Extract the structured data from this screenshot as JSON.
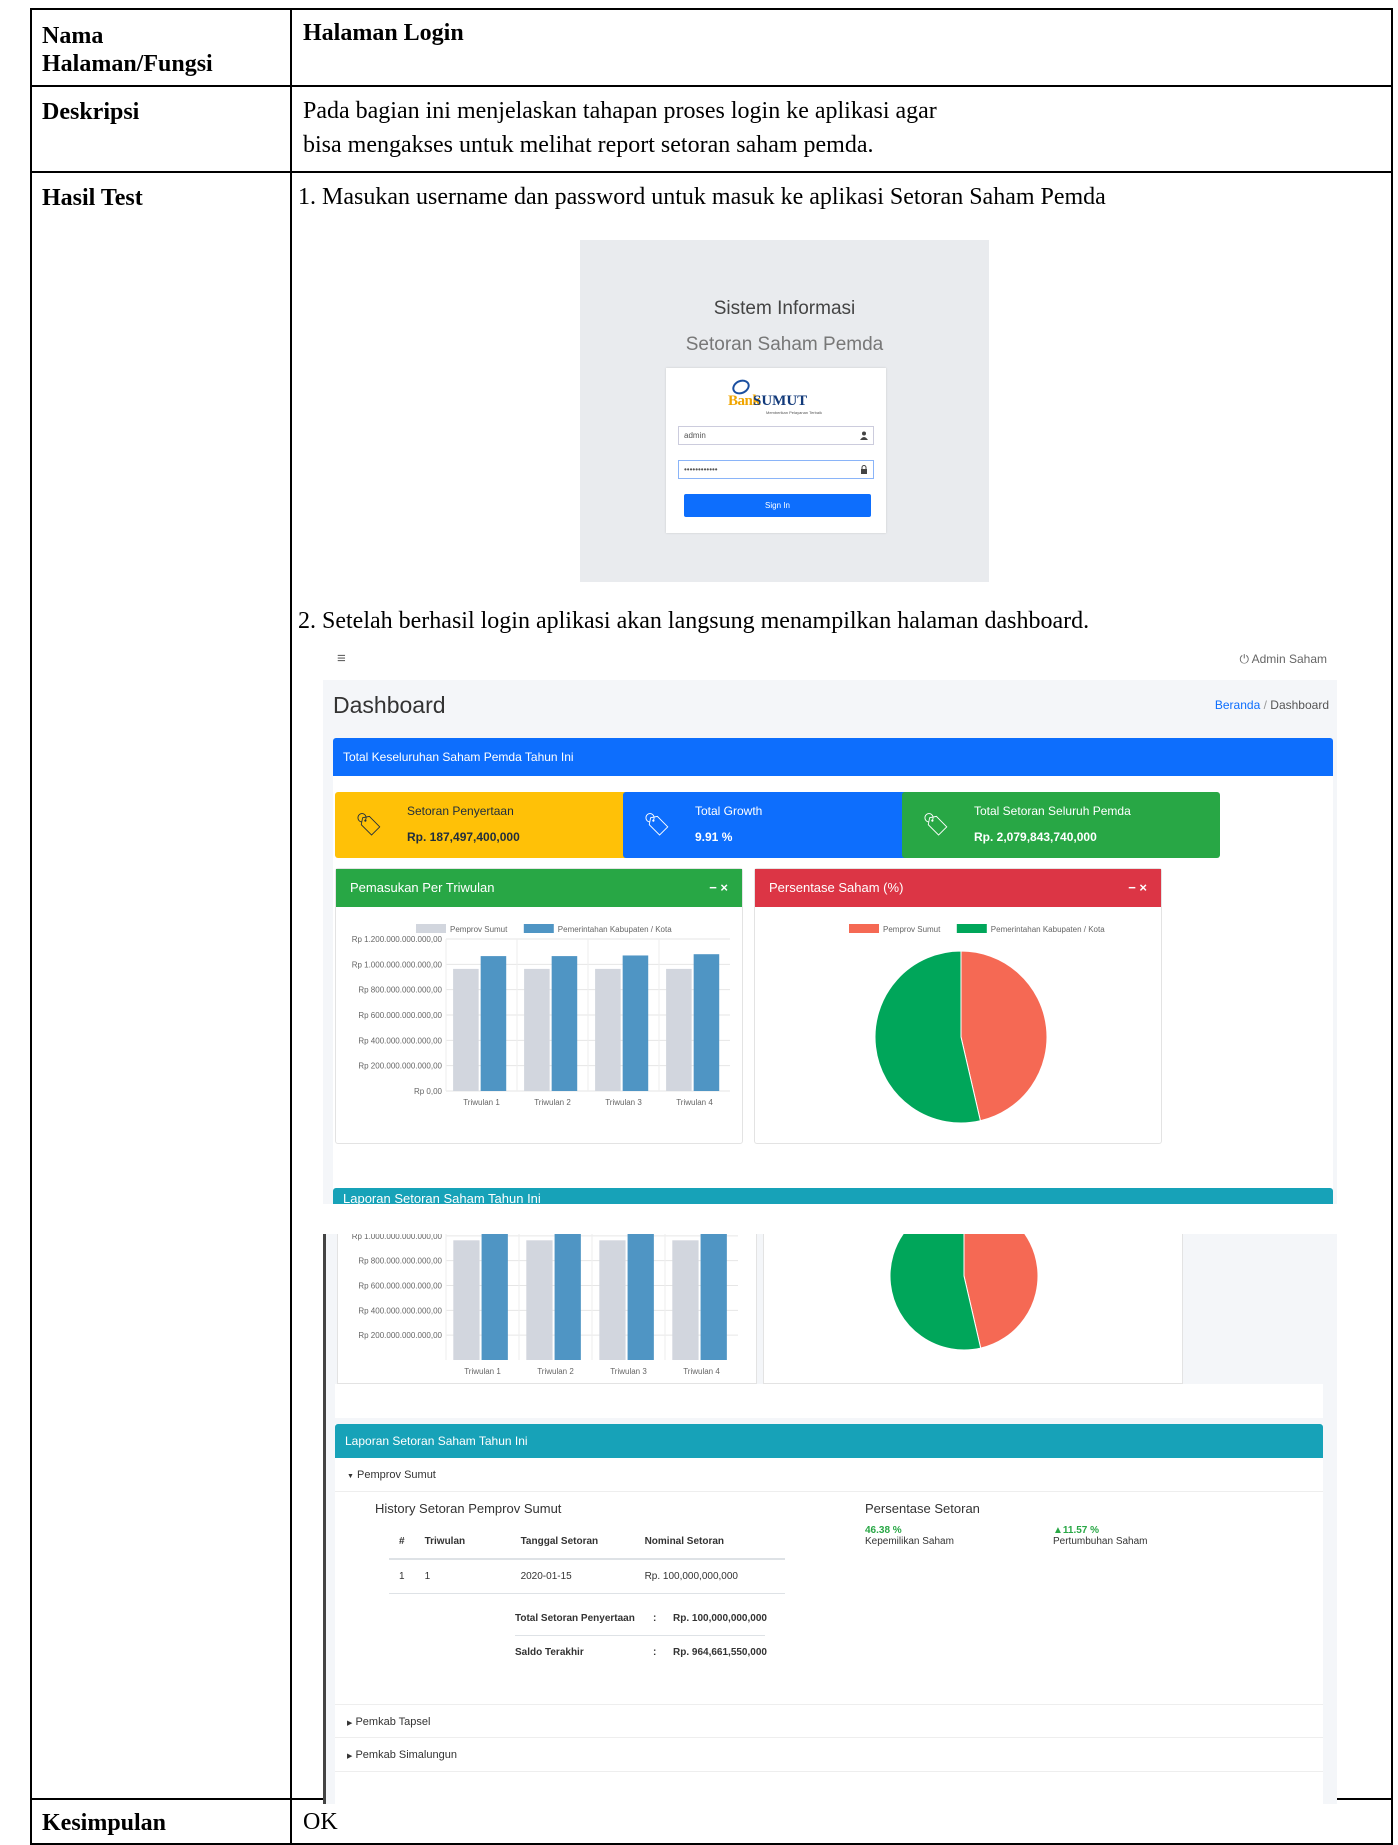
{
  "doc": {
    "rows": [
      {
        "label": "Nama Halaman/Fungsi",
        "value": "Halaman Login"
      },
      {
        "label": "Deskripsi",
        "value_line1": "Pada bagian ini menjelaskan tahapan proses login ke aplikasi agar",
        "value_line2": "bisa mengakses untuk melihat report setoran saham pemda."
      },
      {
        "label": "Hasil Test",
        "step1": "1.   Masukan username dan password untuk masuk ke aplikasi Setoran Saham Pemda",
        "step2": "2.   Setelah berhasil login aplikasi akan langsung menampilkan halaman dashboard."
      },
      {
        "label": "Kesimpulan",
        "value": "OK"
      }
    ]
  },
  "login": {
    "title": "Sistem Informasi",
    "subtitle": "Setoran Saham Pemda",
    "logo_bank": "Bank",
    "logo_name": "SUMUT",
    "logo_tagline": "Memberikan Pelayanan Terbaik",
    "username": "admin",
    "password": "••••••••••••",
    "button": "Sign In",
    "icons": {
      "user": "user-icon",
      "lock": "lock-icon"
    }
  },
  "dashboard": {
    "menu_icon": "≡",
    "user": "Admin Saham",
    "title": "Dashboard",
    "breadcrumb_home": "Beranda",
    "breadcrumb_sep": "/",
    "breadcrumb_current": "Dashboard",
    "panel_title": "Total Keseluruhan Saham Pemda Tahun Ini",
    "info_boxes": [
      {
        "label": "Setoran Penyertaan",
        "value": "Rp. 187,497,400,000",
        "color": "#ffc107"
      },
      {
        "label": "Total Growth",
        "value": "9.91 %",
        "color": "#0d6efd"
      },
      {
        "label": "Total Setoran Seluruh Pemda",
        "value": "Rp. 2,079,843,740,000",
        "color": "#28a745"
      }
    ],
    "bar_box_title": "Pemasukan Per Triwulan",
    "pie_box_title": "Persentase Saham (%)",
    "box_controls": "−   ×",
    "lower_panel_title": "Laporan Setoran Saham Tahun Ini"
  },
  "chart_data": [
    {
      "type": "bar",
      "categories": [
        "Triwulan 1",
        "Triwulan 2",
        "Triwulan 3",
        "Triwulan 4"
      ],
      "series": [
        {
          "name": "Pemprov Sumut",
          "values": [
            964000000000,
            964000000000,
            964000000000,
            964000000000
          ],
          "color": "#d2d6de"
        },
        {
          "name": "Pemerintahan Kabupaten / Kota",
          "values": [
            1065000000000,
            1065000000000,
            1070000000000,
            1080000000000
          ],
          "color": "#4f95c4"
        }
      ],
      "ylim": [
        0,
        1200000000000
      ],
      "yticks": [
        "Rp 0,00",
        "Rp 200.000.000.000,00",
        "Rp 400.000.000.000,00",
        "Rp 600.000.000.000,00",
        "Rp 800.000.000.000,00",
        "Rp 1.000.000.000.000,00",
        "Rp 1.200.000.000.000,00"
      ],
      "legend": "top"
    },
    {
      "type": "pie",
      "labels": [
        "Pemprov Sumut",
        "Pemerintahan Kabupaten / Kota"
      ],
      "values": [
        46.38,
        53.62
      ],
      "colors": [
        "#f56954",
        "#00a65a"
      ],
      "legend": "top"
    }
  ],
  "report": {
    "title": "Laporan Setoran Saham Tahun Ini",
    "section_open": "Pemprov Sumut",
    "history_title": "History Setoran Pemprov Sumut",
    "table_headers": [
      "#",
      "Triwulan",
      "Tanggal Setoran",
      "Nominal Setoran"
    ],
    "table_rows": [
      [
        "1",
        "1",
        "2020-01-15",
        "Rp. 100,000,000,000"
      ]
    ],
    "total_label": "Total Setoran Penyertaan",
    "total_value": "Rp. 100,000,000,000",
    "saldo_label": "Saldo Terakhir",
    "saldo_value": "Rp. 964,661,550,000",
    "colon": ":",
    "persen_title": "Persentase Setoran",
    "kepemilikan_value": "46.38 %",
    "kepemilikan_label": "Kepemilikan Saham",
    "pertumbuhan_value": "▲11.57 %",
    "pertumbuhan_label": "Pertumbuhan Saham",
    "other_sections": [
      "Pemkab Tapsel",
      "Pemkab Simalungun"
    ],
    "caret_open": "▼",
    "caret_closed": "▶"
  }
}
